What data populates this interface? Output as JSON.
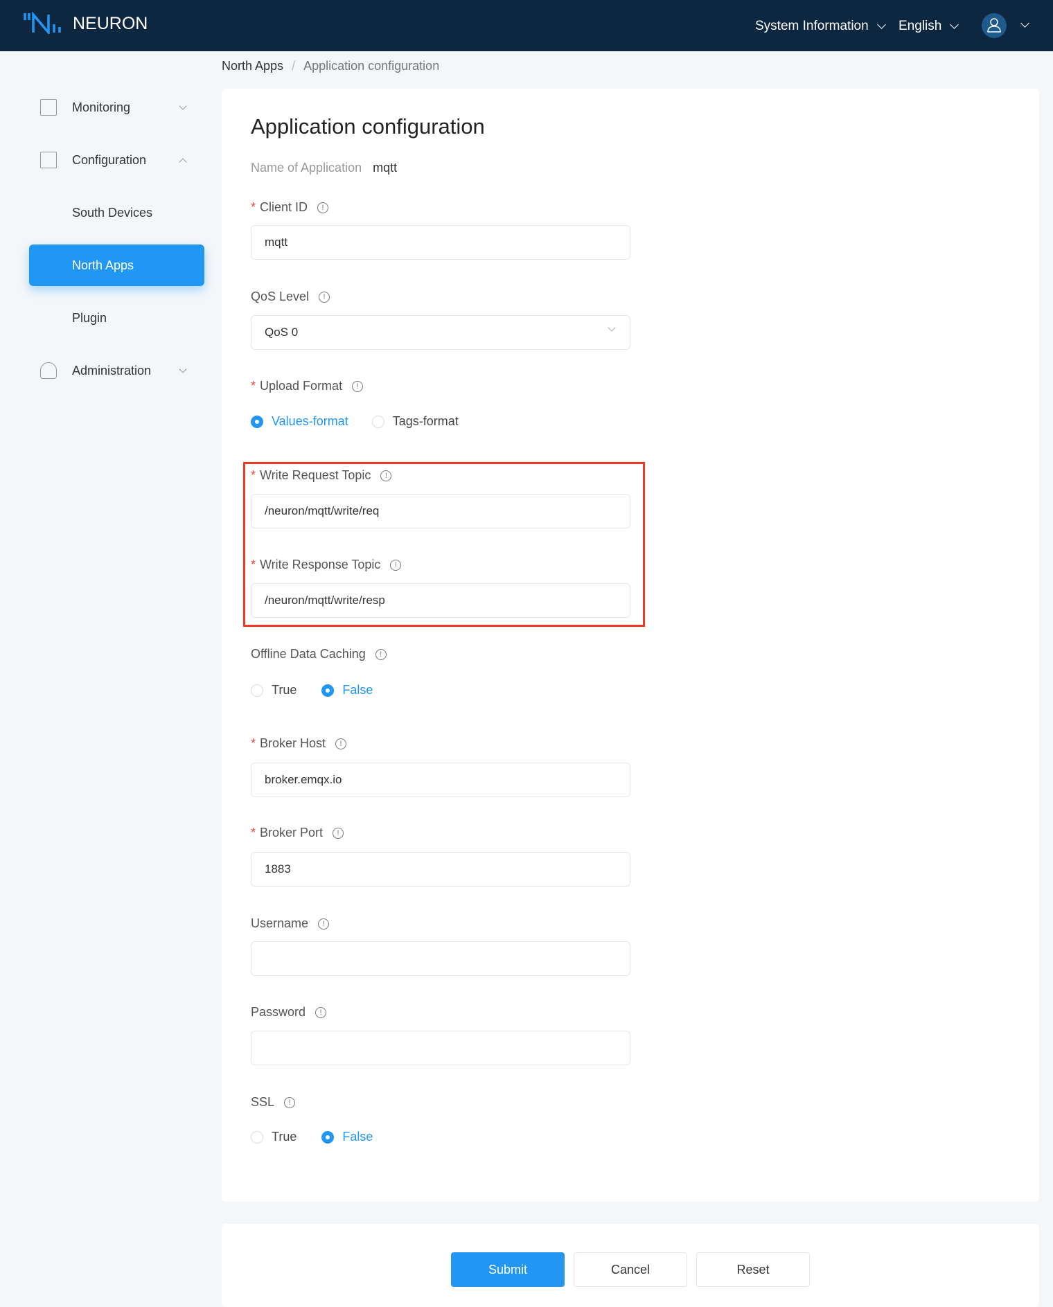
{
  "header": {
    "brand": "NEURON",
    "system_info": "System Information",
    "language": "English"
  },
  "breadcrumb": {
    "parent": "North Apps",
    "sep": "/",
    "current": "Application configuration"
  },
  "sidebar": {
    "items": [
      {
        "label": "Monitoring"
      },
      {
        "label": "Configuration"
      },
      {
        "label": "South Devices"
      },
      {
        "label": "North Apps"
      },
      {
        "label": "Plugin"
      },
      {
        "label": "Administration"
      }
    ]
  },
  "form": {
    "title": "Application configuration",
    "name_label": "Name of Application",
    "name_value": "mqtt",
    "client_id": {
      "label": "Client ID",
      "value": "mqtt"
    },
    "qos": {
      "label": "QoS Level",
      "value": "QoS 0"
    },
    "upload_format": {
      "label": "Upload Format",
      "options": [
        "Values-format",
        "Tags-format"
      ],
      "selected": "Values-format"
    },
    "write_req": {
      "label": "Write Request Topic",
      "value": "/neuron/mqtt/write/req"
    },
    "write_resp": {
      "label": "Write Response Topic",
      "value": "/neuron/mqtt/write/resp"
    },
    "offline_cache": {
      "label": "Offline Data Caching",
      "options": [
        "True",
        "False"
      ],
      "selected": "False"
    },
    "broker_host": {
      "label": "Broker Host",
      "value": "broker.emqx.io"
    },
    "broker_port": {
      "label": "Broker Port",
      "value": "1883"
    },
    "username": {
      "label": "Username",
      "value": ""
    },
    "password": {
      "label": "Password",
      "value": ""
    },
    "ssl": {
      "label": "SSL",
      "options": [
        "True",
        "False"
      ],
      "selected": "False"
    },
    "required_mark": "*"
  },
  "actions": {
    "submit": "Submit",
    "cancel": "Cancel",
    "reset": "Reset"
  },
  "colors": {
    "accent": "#2196f3",
    "header": "#0e2740",
    "highlight": "#ee3a24"
  }
}
